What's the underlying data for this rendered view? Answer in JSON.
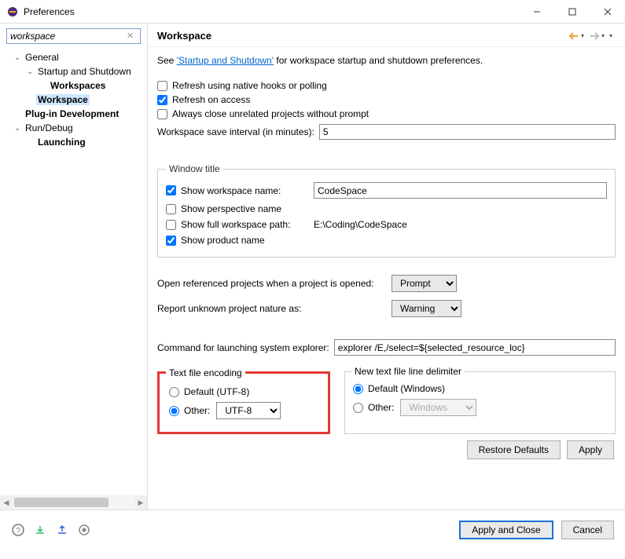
{
  "window": {
    "title": "Preferences"
  },
  "search": {
    "value": "workspace"
  },
  "tree": {
    "general": "General",
    "startup_shutdown": "Startup and Shutdown",
    "workspaces": "Workspaces",
    "workspace": "Workspace",
    "plugin_dev": "Plug-in Development",
    "run_debug": "Run/Debug",
    "launching": "Launching"
  },
  "page": {
    "title": "Workspace",
    "desc_prefix": "See ",
    "desc_link": "'Startup and Shutdown'",
    "desc_suffix": " for workspace startup and shutdown preferences.",
    "refresh_native": "Refresh using native hooks or polling",
    "refresh_access": "Refresh on access",
    "auto_close": "Always close unrelated projects without prompt",
    "interval_label": "Workspace save interval (in minutes):",
    "interval_value": "5",
    "window_title_legend": "Window title",
    "show_workspace_name": "Show workspace name:",
    "workspace_name_value": "CodeSpace",
    "show_perspective": "Show perspective name",
    "show_full_path": "Show full workspace path:",
    "full_path_value": "E:\\Coding\\CodeSpace",
    "show_product": "Show product name",
    "open_referenced_label": "Open referenced projects when a project is opened:",
    "open_referenced_value": "Prompt",
    "unknown_nature_label": "Report unknown project nature as:",
    "unknown_nature_value": "Warning",
    "explorer_label": "Command for launching system explorer:",
    "explorer_value": "explorer /E,/select=${selected_resource_loc}",
    "encoding_legend": "Text file encoding",
    "encoding_default": "Default (UTF-8)",
    "encoding_other": "Other:",
    "encoding_value": "UTF-8",
    "delimiter_legend": "New text file line delimiter",
    "delimiter_default": "Default (Windows)",
    "delimiter_other": "Other:",
    "delimiter_value": "Windows",
    "restore_defaults": "Restore Defaults",
    "apply": "Apply"
  },
  "footer": {
    "apply_close": "Apply and Close",
    "cancel": "Cancel"
  }
}
